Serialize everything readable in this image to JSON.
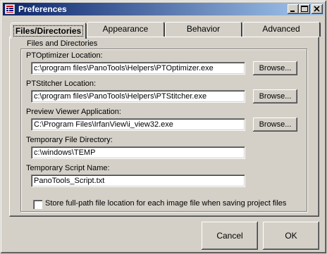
{
  "window": {
    "title": "Preferences"
  },
  "tabs": [
    {
      "label": "Files/Directories",
      "active": true
    },
    {
      "label": "Appearance",
      "active": false
    },
    {
      "label": "Behavior",
      "active": false
    },
    {
      "label": "Advanced",
      "active": false
    }
  ],
  "group": {
    "title": "Files and Directories",
    "ptoptimizer": {
      "label": "PTOptimizer Location:",
      "value": "c:\\program files\\PanoTools\\Helpers\\PTOptimizer.exe",
      "button": "Browse..."
    },
    "ptstitcher": {
      "label": "PTStitcher Location:",
      "value": "c:\\program files\\PanoTools\\Helpers\\PTStitcher.exe",
      "button": "Browse..."
    },
    "preview": {
      "label": "Preview Viewer Application:",
      "value": "C:\\Program Files\\IrfanView\\i_view32.exe",
      "button": "Browse..."
    },
    "temp_dir": {
      "label": "Temporary File Directory:",
      "value": "c:\\windows\\TEMP"
    },
    "temp_script": {
      "label": "Temporary Script Name:",
      "value": "PanoTools_Script.txt"
    },
    "store_fullpath": {
      "label": "Store full-path file location for each image file when saving project files",
      "checked": false
    }
  },
  "buttons": {
    "cancel": "Cancel",
    "ok": "OK"
  },
  "icons": {
    "app": "preferences-app-icon",
    "minimize": "minimize-icon",
    "maximize": "maximize-icon",
    "close": "close-icon"
  }
}
